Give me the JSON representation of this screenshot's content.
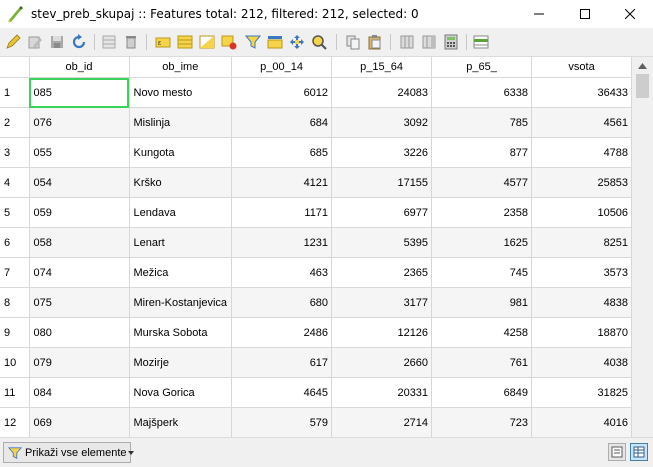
{
  "window": {
    "title": "stev_preb_skupaj :: Features total: 212, filtered: 212, selected: 0",
    "app_icon": "qgis-icon"
  },
  "toolbar": {
    "buttons": [
      "toggle-edit-icon",
      "multi-edit-icon",
      "save-edits-icon",
      "reload-icon",
      "add-feature-icon",
      "delete-features-icon",
      "select-expression-icon",
      "select-all-icon",
      "invert-selection-icon",
      "deselect-all-icon",
      "filter-icon",
      "move-selection-top-icon",
      "pan-to-selected-icon",
      "zoom-to-selected-icon",
      "copy-rows-icon",
      "paste-features-icon",
      "delete-field-icon",
      "new-field-icon",
      "field-calculator-icon",
      "conditional-formatting-icon"
    ]
  },
  "table": {
    "columns": [
      "ob_id",
      "ob_ime",
      "p_00_14",
      "p_15_64",
      "p_65_",
      "vsota"
    ],
    "rows": [
      {
        "n": "1",
        "ob_id": "085",
        "ob_ime": "Novo mesto",
        "p_00_14": "6012",
        "p_15_64": "24083",
        "p_65_": "6338",
        "vsota": "36433"
      },
      {
        "n": "2",
        "ob_id": "076",
        "ob_ime": "Mislinja",
        "p_00_14": "684",
        "p_15_64": "3092",
        "p_65_": "785",
        "vsota": "4561"
      },
      {
        "n": "3",
        "ob_id": "055",
        "ob_ime": "Kungota",
        "p_00_14": "685",
        "p_15_64": "3226",
        "p_65_": "877",
        "vsota": "4788"
      },
      {
        "n": "4",
        "ob_id": "054",
        "ob_ime": "Krško",
        "p_00_14": "4121",
        "p_15_64": "17155",
        "p_65_": "4577",
        "vsota": "25853"
      },
      {
        "n": "5",
        "ob_id": "059",
        "ob_ime": "Lendava",
        "p_00_14": "1171",
        "p_15_64": "6977",
        "p_65_": "2358",
        "vsota": "10506"
      },
      {
        "n": "6",
        "ob_id": "058",
        "ob_ime": "Lenart",
        "p_00_14": "1231",
        "p_15_64": "5395",
        "p_65_": "1625",
        "vsota": "8251"
      },
      {
        "n": "7",
        "ob_id": "074",
        "ob_ime": "Mežica",
        "p_00_14": "463",
        "p_15_64": "2365",
        "p_65_": "745",
        "vsota": "3573"
      },
      {
        "n": "8",
        "ob_id": "075",
        "ob_ime": "Miren-Kostanjevica",
        "p_00_14": "680",
        "p_15_64": "3177",
        "p_65_": "981",
        "vsota": "4838"
      },
      {
        "n": "9",
        "ob_id": "080",
        "ob_ime": "Murska Sobota",
        "p_00_14": "2486",
        "p_15_64": "12126",
        "p_65_": "4258",
        "vsota": "18870"
      },
      {
        "n": "10",
        "ob_id": "079",
        "ob_ime": "Mozirje",
        "p_00_14": "617",
        "p_15_64": "2660",
        "p_65_": "761",
        "vsota": "4038"
      },
      {
        "n": "11",
        "ob_id": "084",
        "ob_ime": "Nova Gorica",
        "p_00_14": "4645",
        "p_15_64": "20331",
        "p_65_": "6849",
        "vsota": "31825"
      },
      {
        "n": "12",
        "ob_id": "069",
        "ob_ime": "Majšperk",
        "p_00_14": "579",
        "p_15_64": "2714",
        "p_65_": "723",
        "vsota": "4016"
      }
    ]
  },
  "bottom": {
    "show_all_label": "Prikaži vse elemente"
  },
  "colors": {
    "selected_cell_outline": "#39d35a",
    "alt_row": "#f5f5f5"
  }
}
